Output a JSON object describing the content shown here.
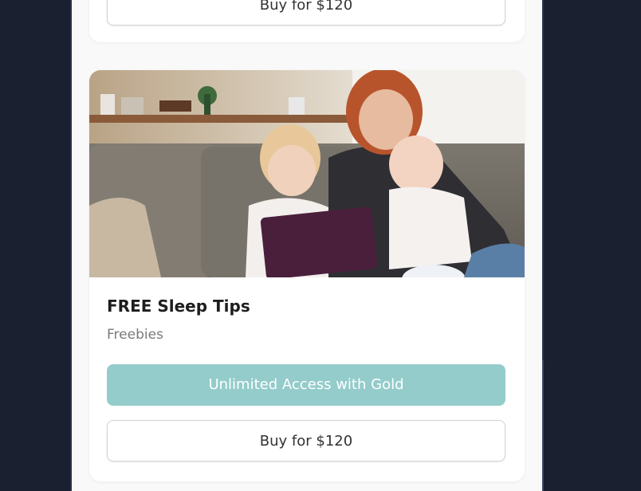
{
  "cards": [
    {
      "buy_label": "Buy for $120"
    },
    {
      "title": "FREE Sleep Tips",
      "category": "Freebies",
      "gold_label": "Unlimited Access with Gold",
      "buy_label": "Buy for $120",
      "image_alt": "Mother with two children looking at a tablet on a couch"
    }
  ],
  "colors": {
    "background": "#1b2031",
    "gold_button": "#93cccb",
    "card": "#ffffff"
  }
}
